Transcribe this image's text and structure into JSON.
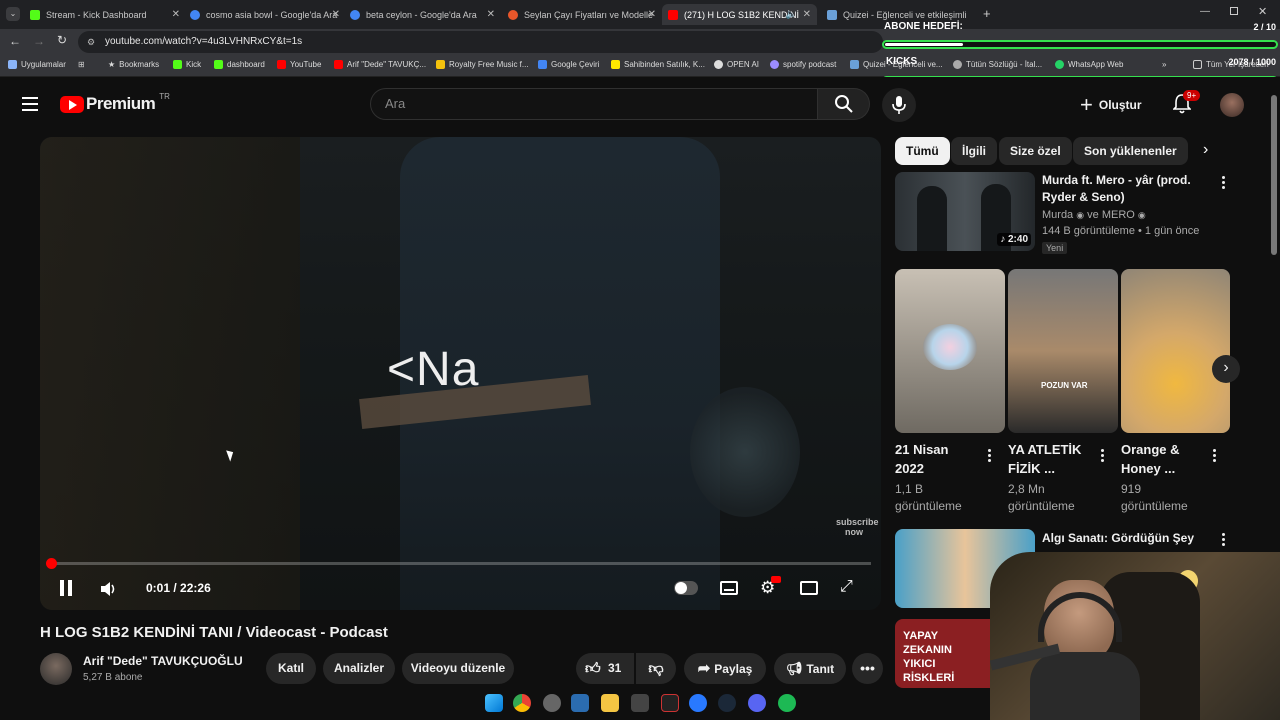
{
  "tabs": [
    {
      "label": "Stream - Kick Dashboard",
      "color": "#53fc18"
    },
    {
      "label": "cosmo asia bowl - Google'da Ara",
      "color": "#4285f4"
    },
    {
      "label": "beta ceylon - Google'da Ara",
      "color": "#4285f4"
    },
    {
      "label": "Seylan Çayı Fiyatları ve Modelle",
      "color": "#e8562a"
    },
    {
      "label": "(271) H LOG S1B2 KENDİNİ",
      "color": "#ff0000"
    },
    {
      "label": "Quizei - Eğlenceli ve etkileşimli",
      "color": "#6aa0d8"
    }
  ],
  "address": {
    "url": "youtube.com/watch?v=4u3LVHNRxCY&t=1s"
  },
  "bookmarks": [
    "Uygulamalar",
    "Bookmarks",
    "Kick",
    "dashboard",
    "YouTube",
    "Arif \"Dede\" TAVUKÇ...",
    "Royalty Free Music f...",
    "Google Çeviri",
    "Sahibinden Satılık, K...",
    "OPEN AI",
    "spotify podcast",
    "Quizei - Eğlenceli ve...",
    "Tütün Sözlüğü - İtal...",
    "WhatsApp Web",
    "Tüm Yer İşaretleri"
  ],
  "overlay": {
    "title": "ABONE HEDEFİ:",
    "count": "2 / 10",
    "progress": 0.2,
    "kicks_label": "KICKS",
    "kicks_count": "2078 / 1000",
    "kicks_progress": 1.0
  },
  "yt": {
    "logo": "Premium",
    "region": "TR",
    "search_placeholder": "Ara",
    "create_label": "Oluştur",
    "notif_badge": "9+"
  },
  "video": {
    "overlay_text": "<Na",
    "watermark": "subscribe now",
    "time_current": "0:01",
    "time_total": "22:26",
    "time_sep": " / ",
    "progress": 0.001,
    "title": "H LOG S1B2 KENDİNİ TANI / Videocast - Podcast",
    "channel": "Arif \"Dede\" TAVUKÇUOĞLU",
    "subs": "5,27 B abone",
    "buttons": {
      "join": "Katıl",
      "analytics": "Analizler",
      "edit": "Videoyu düzenle",
      "likes": "31",
      "share": "Paylaş",
      "promote": "Tanıt"
    }
  },
  "chips": [
    "Tümü",
    "İlgili",
    "Size özel",
    "Son yüklenenler"
  ],
  "recommended": {
    "first": {
      "title": "Murda ft. Mero - yâr (prod. Ryder & Seno)",
      "channel": "Murda",
      "channel2": "ve MERO",
      "meta": "144 B görüntüleme • 1 gün önce",
      "badge": "Yeni",
      "duration": "2:40"
    },
    "shorts": [
      {
        "title": "21 Nisan 2022",
        "views": "1,1 B görüntüleme"
      },
      {
        "title": "YA ATLETİK FİZİK ...",
        "views": "2,8 Mn görüntüleme",
        "thumb_text": "POZUN VAR"
      },
      {
        "title": "Orange & Honey ...",
        "views": "919 görüntüleme"
      }
    ],
    "third": {
      "title": "Algı Sanatı: Gördüğün Şey Sandığın Yalan S..."
    },
    "fourth": {
      "thumb_text": "YAPAY ZEKANIN YIKICI RİSKLERİ"
    }
  }
}
